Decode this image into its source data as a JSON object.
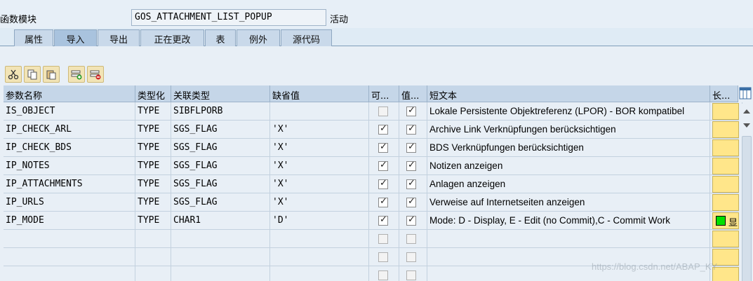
{
  "header": {
    "label": "函数模块",
    "function_name": "GOS_ATTACHMENT_LIST_POPUP",
    "status": "活动"
  },
  "tabs": [
    "属性",
    "导入",
    "导出",
    "正在更改",
    "表",
    "例外",
    "源代码"
  ],
  "active_tab": "导入",
  "toolbar": {
    "icons": [
      "cut-icon",
      "copy-icon",
      "paste-icon",
      "insert-row-icon",
      "delete-row-icon"
    ]
  },
  "table": {
    "columns": [
      "参数名称",
      "类型化",
      "关联类型",
      "缺省值",
      "可...",
      "值...",
      "短文本",
      "长..."
    ],
    "rows": [
      {
        "name": "IS_OBJECT",
        "typing": "TYPE",
        "ref": "SIBFLPORB",
        "default": "",
        "optional": false,
        "pass_value": true,
        "short_text": "Lokale Persistente Objektreferenz (LPOR) - BOR kompatibel",
        "long": ""
      },
      {
        "name": "IP_CHECK_ARL",
        "typing": "TYPE",
        "ref": "SGS_FLAG",
        "default": "'X'",
        "optional": true,
        "pass_value": true,
        "short_text": "Archive Link Verknüpfungen berücksichtigen",
        "long": ""
      },
      {
        "name": "IP_CHECK_BDS",
        "typing": "TYPE",
        "ref": "SGS_FLAG",
        "default": "'X'",
        "optional": true,
        "pass_value": true,
        "short_text": "BDS Verknüpfungen berücksichtigen",
        "long": ""
      },
      {
        "name": "IP_NOTES",
        "typing": "TYPE",
        "ref": "SGS_FLAG",
        "default": "'X'",
        "optional": true,
        "pass_value": true,
        "short_text": "Notizen anzeigen",
        "long": ""
      },
      {
        "name": "IP_ATTACHMENTS",
        "typing": "TYPE",
        "ref": "SGS_FLAG",
        "default": "'X'",
        "optional": true,
        "pass_value": true,
        "short_text": "Anlagen anzeigen",
        "long": ""
      },
      {
        "name": "IP_URLS",
        "typing": "TYPE",
        "ref": "SGS_FLAG",
        "default": "'X'",
        "optional": true,
        "pass_value": true,
        "short_text": "Verweise auf Internetseiten anzeigen",
        "long": ""
      },
      {
        "name": "IP_MODE",
        "typing": "TYPE",
        "ref": "CHAR1",
        "default": "'D'",
        "optional": true,
        "pass_value": true,
        "short_text": "Mode: D - Display, E - Edit (no Commit),C - Commit Work",
        "long": "显"
      }
    ],
    "empty_rows": 3
  },
  "watermark": "https://blog.csdn.net/ABAP_KY"
}
